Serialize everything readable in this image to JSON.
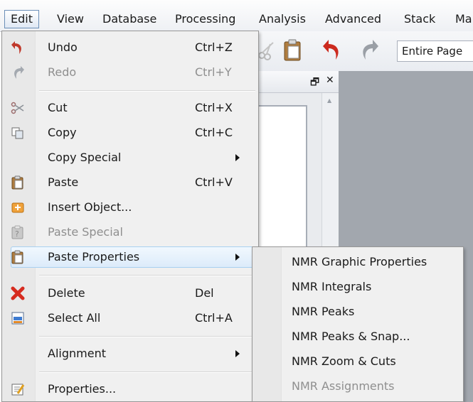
{
  "menubar": {
    "items": [
      {
        "label": "Edit",
        "active": true
      },
      {
        "label": "View"
      },
      {
        "label": "Database"
      },
      {
        "label": "Processing"
      },
      {
        "label": "Analysis"
      },
      {
        "label": "Advanced"
      },
      {
        "label": "Stack"
      },
      {
        "label": "Ma"
      }
    ]
  },
  "toolbar": {
    "zoom_value": "Entire Page"
  },
  "panel": {
    "restore_glyph": "🗗",
    "close_glyph": "✕",
    "scroll_up_glyph": "▲"
  },
  "edit_menu": {
    "items": [
      {
        "label": "Undo",
        "shortcut": "Ctrl+Z",
        "icon": "undo-icon"
      },
      {
        "label": "Redo",
        "shortcut": "Ctrl+Y",
        "icon": "redo-icon",
        "disabled": true
      },
      {
        "label": "Cut",
        "shortcut": "Ctrl+X",
        "icon": "scissors-icon"
      },
      {
        "label": "Copy",
        "shortcut": "Ctrl+C",
        "icon": "copy-icon"
      },
      {
        "label": "Copy Special",
        "shortcut": "",
        "submenu": true
      },
      {
        "label": "Paste",
        "shortcut": "Ctrl+V",
        "icon": "clipboard-icon"
      },
      {
        "label": "Insert Object...",
        "shortcut": "",
        "icon": "insert-object-icon"
      },
      {
        "label": "Paste Special",
        "shortcut": "",
        "icon": "paste-special-icon",
        "disabled": true
      },
      {
        "label": "Paste Properties",
        "shortcut": "",
        "icon": "clipboard-icon",
        "submenu": true,
        "highlighted": true
      },
      {
        "label": "Delete",
        "shortcut": "Del",
        "icon": "delete-x-icon"
      },
      {
        "label": "Select All",
        "shortcut": "Ctrl+A",
        "icon": "select-all-icon"
      },
      {
        "label": "Alignment",
        "shortcut": "",
        "submenu": true
      },
      {
        "label": "Properties...",
        "shortcut": "",
        "icon": "properties-icon"
      }
    ]
  },
  "paste_properties_submenu": {
    "items": [
      {
        "label": "NMR Graphic Properties"
      },
      {
        "label": "NMR Integrals"
      },
      {
        "label": "NMR Peaks"
      },
      {
        "label": "NMR Peaks & Snap..."
      },
      {
        "label": "NMR Zoom & Cuts"
      },
      {
        "label": "NMR Assignments",
        "disabled": true
      }
    ]
  },
  "colors": {
    "accent_highlight": "#dcebfa",
    "undo_red": "#c0392b",
    "delete_red": "#d62b1f",
    "disabled_text": "#8f8f8f"
  }
}
